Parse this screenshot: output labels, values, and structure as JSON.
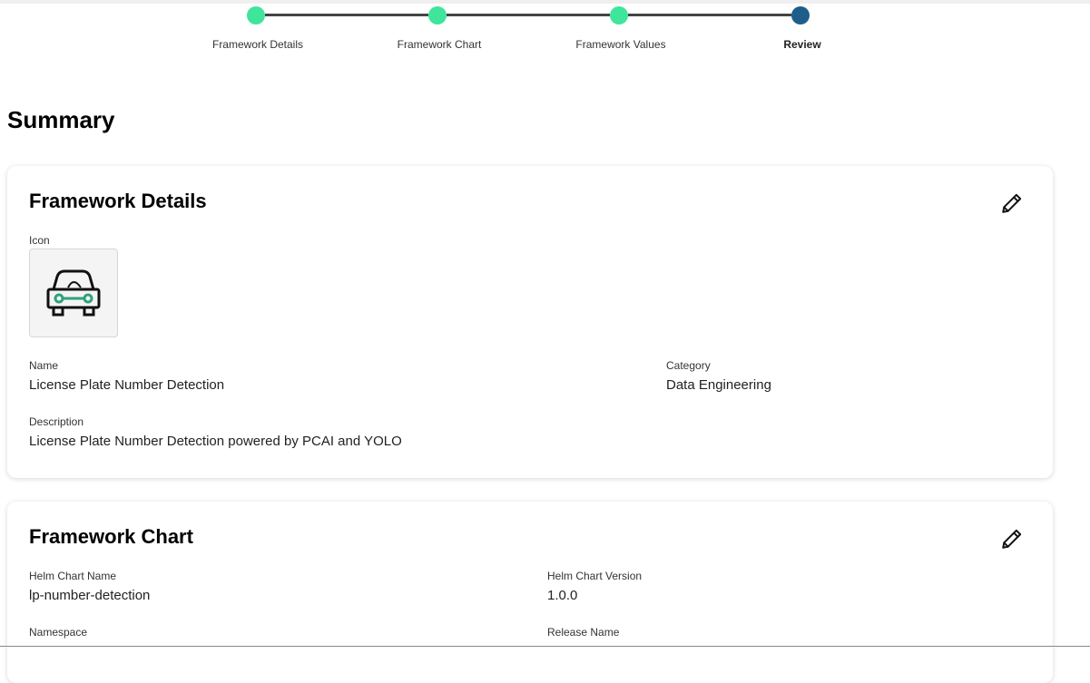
{
  "stepper": {
    "steps": [
      {
        "label": "Framework Details",
        "status": "complete"
      },
      {
        "label": "Framework Chart",
        "status": "complete"
      },
      {
        "label": "Framework Values",
        "status": "complete"
      },
      {
        "label": "Review",
        "status": "current"
      }
    ],
    "colors": {
      "complete": "#3ee59b",
      "current": "#1f5e8a",
      "line": "#444444"
    }
  },
  "page": {
    "title": "Summary"
  },
  "details": {
    "title": "Framework Details",
    "edit_icon": "pencil-icon",
    "icon_label": "Icon",
    "icon_image": "car-icon",
    "name_label": "Name",
    "name_value": "License Plate Number Detection",
    "category_label": "Category",
    "category_value": "Data Engineering",
    "description_label": "Description",
    "description_value": "License Plate Number Detection powered by PCAI and YOLO"
  },
  "chart": {
    "title": "Framework Chart",
    "edit_icon": "pencil-icon",
    "helm_name_label": "Helm Chart Name",
    "helm_name_value": "lp-number-detection",
    "helm_version_label": "Helm Chart Version",
    "helm_version_value": "1.0.0",
    "namespace_label": "Namespace",
    "release_name_label": "Release Name"
  }
}
